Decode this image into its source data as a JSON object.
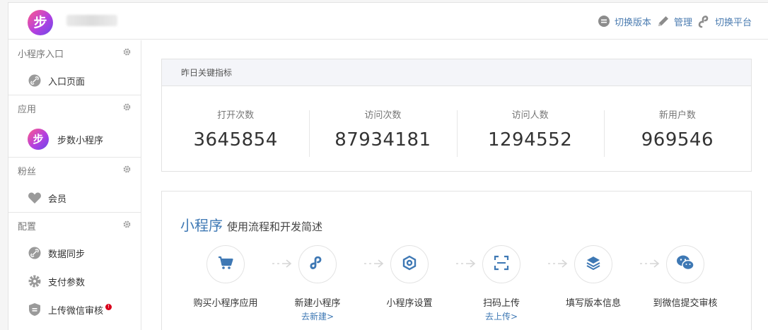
{
  "header": {
    "logo_text": "步",
    "actions": [
      {
        "label": "切换版本",
        "icon": "switch-version-icon"
      },
      {
        "label": "管理",
        "icon": "pencil-icon"
      },
      {
        "label": "切换平台",
        "icon": "link-icon"
      }
    ]
  },
  "sidebar": {
    "groups": [
      {
        "title": "小程序入口",
        "items": [
          {
            "label": "入口页面",
            "icon": "link-icon"
          }
        ]
      },
      {
        "title": "应用",
        "items": [
          {
            "label": "步数小程序",
            "icon": "app-logo",
            "logo_text": "步"
          }
        ]
      },
      {
        "title": "粉丝",
        "items": [
          {
            "label": "会员",
            "icon": "heart-icon"
          }
        ]
      },
      {
        "title": "配置",
        "items": [
          {
            "label": "数据同步",
            "icon": "link-icon"
          },
          {
            "label": "支付参数",
            "icon": "gear-icon"
          },
          {
            "label": "上传微信审核",
            "icon": "shield-icon",
            "badge": "!"
          }
        ]
      }
    ]
  },
  "metrics": {
    "title": "昨日关键指标",
    "items": [
      {
        "label": "打开次数",
        "value": "3645854"
      },
      {
        "label": "访问次数",
        "value": "87934181"
      },
      {
        "label": "访问人数",
        "value": "1294552"
      },
      {
        "label": "新用户数",
        "value": "969546"
      }
    ]
  },
  "flow": {
    "title": "小程序",
    "subtitle": "使用流程和开发简述",
    "steps": [
      {
        "name": "购买小程序应用",
        "link": "",
        "icon": "cart-icon"
      },
      {
        "name": "新建小程序",
        "link": "去新建>",
        "icon": "mini-program-icon"
      },
      {
        "name": "小程序设置",
        "link": "",
        "icon": "settings-hex-icon"
      },
      {
        "name": "扫码上传",
        "link": "去上传>",
        "icon": "scan-icon"
      },
      {
        "name": "填写版本信息",
        "link": "",
        "icon": "layers-icon"
      },
      {
        "name": "到微信提交审核",
        "link": "",
        "icon": "wechat-icon"
      }
    ]
  },
  "colors": {
    "accent": "#3e78b4",
    "badge": "#d9001b",
    "icon_grey": "#9a9a9a"
  }
}
